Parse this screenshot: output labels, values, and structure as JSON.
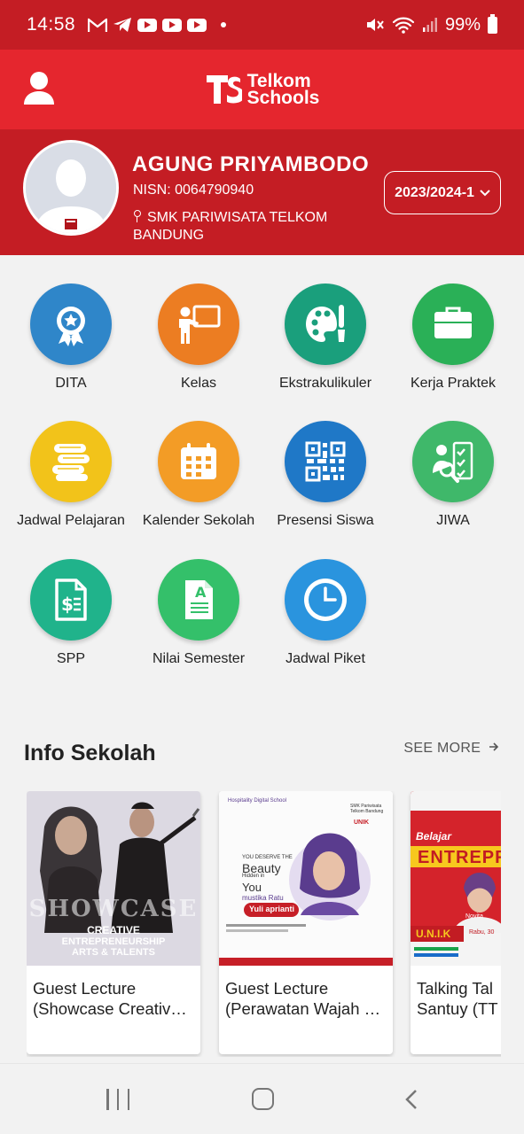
{
  "status_bar": {
    "time": "14:58",
    "battery": "99%",
    "icons": [
      "gmail-icon",
      "telegram-icon",
      "youtube-icon",
      "youtube-icon",
      "youtube-icon",
      "dot-icon",
      "mute-icon",
      "wifi-icon",
      "signal-icon",
      "battery-icon"
    ]
  },
  "app_bar": {
    "logo_line1": "Telkom",
    "logo_line2": "Schools",
    "user_icon": "user-icon"
  },
  "profile": {
    "name": "AGUNG PRIYAMBODO",
    "nisn": "NISN: 0064790940",
    "school": "SMK PARIWISATA TELKOM BANDUNG",
    "year": "2023/2024-1"
  },
  "menu": [
    {
      "label": "DITA",
      "icon": "award-badge-icon",
      "color": "#2f86c9"
    },
    {
      "label": "Kelas",
      "icon": "teacher-board-icon",
      "color": "#ec7d22"
    },
    {
      "label": "Ekstrakulikuler",
      "icon": "palette-brush-icon",
      "color": "#1a9f7c"
    },
    {
      "label": "Kerja Praktek",
      "icon": "briefcase-icon",
      "color": "#2ab057"
    },
    {
      "label": "Jadwal Pelajaran",
      "icon": "books-icon",
      "color": "#f2c31a"
    },
    {
      "label": "Kalender Sekolah",
      "icon": "calendar-icon",
      "color": "#f39c26"
    },
    {
      "label": "Presensi Siswa",
      "icon": "qr-code-icon",
      "color": "#1f78c7"
    },
    {
      "label": "JIWA",
      "icon": "checklist-search-icon",
      "color": "#3fb86a"
    },
    {
      "label": "SPP",
      "icon": "invoice-dollar-icon",
      "color": "#20b38b"
    },
    {
      "label": "Nilai Semester",
      "icon": "grade-document-icon",
      "color": "#34c06a"
    },
    {
      "label": "Jadwal Piket",
      "icon": "clock-icon",
      "color": "#2a94de"
    }
  ],
  "info": {
    "title": "Info Sekolah",
    "see_more": "SEE MORE",
    "cards": [
      {
        "line1": "Guest Lecture",
        "line2": "(Showcase Creativ…",
        "poster_text": [
          "SHOWCASE",
          "CREATIVE",
          "ENTREPRENEURSHIP",
          "ARTS & TALENTS"
        ]
      },
      {
        "line1": "Guest Lecture",
        "line2": "(Perawatan Wajah …",
        "poster_text": [
          "Hospitality Digital School",
          "SMK Pariwisata Telkom Bandung",
          "UNIK",
          "YOU DESERVE THE",
          "Beauty",
          "Hidden in",
          "You",
          "mustika Ratu",
          "Yuli aprianti"
        ]
      },
      {
        "line1": "Talking Tal",
        "line2": "Santuy (TT",
        "poster_text": [
          "Belajar",
          "ENTREPR",
          "U.N.I.K",
          "Novita",
          "Rabu, 30"
        ]
      }
    ]
  },
  "nav_bar": {
    "buttons": [
      "recent-apps-icon",
      "home-icon",
      "back-icon"
    ]
  }
}
